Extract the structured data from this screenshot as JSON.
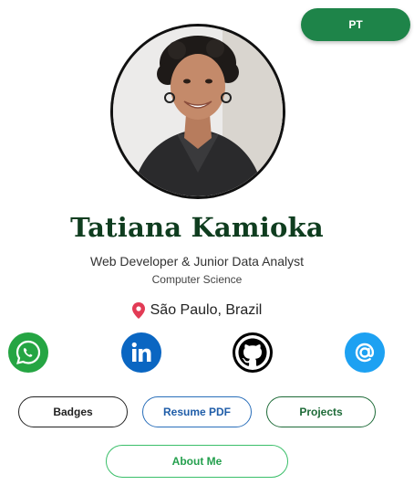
{
  "header": {
    "language_button": "PT"
  },
  "profile": {
    "name": "Tatiana Kamioka",
    "role": "Web Developer & Junior Data Analyst",
    "field": "Computer Science",
    "location": "São Paulo, Brazil",
    "avatar_alt": "Tatiana Kamioka"
  },
  "social": [
    {
      "name": "whatsapp",
      "icon": "whatsapp-icon",
      "color": "#25a543"
    },
    {
      "name": "linkedin",
      "icon": "linkedin-icon",
      "color": "#0a66c2"
    },
    {
      "name": "github",
      "icon": "github-icon",
      "color": "#000000"
    },
    {
      "name": "email",
      "icon": "at-icon",
      "color": "#1da1f2"
    }
  ],
  "buttons": {
    "badges": "Badges",
    "resume": "Resume PDF",
    "projects": "Projects",
    "about": "About Me"
  },
  "colors": {
    "accent_green": "#1e8449",
    "name_color": "#0f3d1f",
    "resume_blue": "#1f5da8"
  }
}
